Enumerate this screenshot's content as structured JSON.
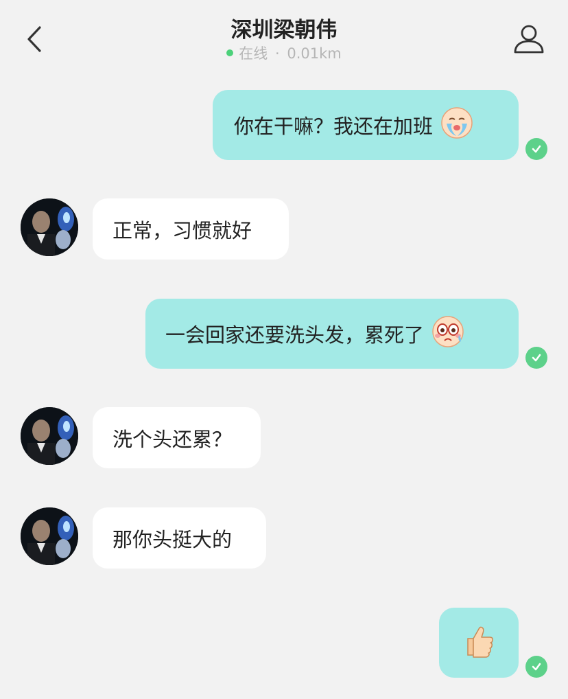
{
  "header": {
    "title": "深圳梁朝伟",
    "status_online": "在线",
    "status_separator": "·",
    "status_distance": "0.01km"
  },
  "colors": {
    "outgoing_bubble": "#a3eae6",
    "incoming_bubble": "#ffffff",
    "online_dot": "#4cd17a",
    "read_check": "#5dd18a",
    "background": "#f2f2f2"
  },
  "messages": [
    {
      "direction": "out",
      "text": "你在干嘛？我还在加班",
      "emoji": "crying-face-emoji",
      "status": "read"
    },
    {
      "direction": "in",
      "text": "正常，习惯就好"
    },
    {
      "direction": "out",
      "text": "一会回家还要洗头发，累死了",
      "emoji": "teary-face-emoji",
      "status": "read"
    },
    {
      "direction": "in",
      "text": "洗个头还累？"
    },
    {
      "direction": "in",
      "text": "那你头挺大的"
    },
    {
      "direction": "out",
      "text": "",
      "emoji": "thumbs-up-emoji",
      "status": "read"
    }
  ]
}
